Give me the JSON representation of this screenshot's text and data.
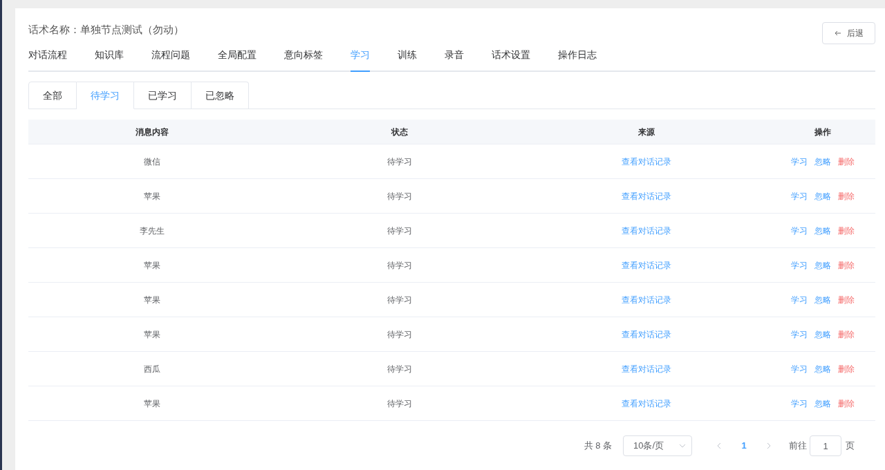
{
  "header": {
    "title": "话术名称：单独节点测试（勿动）",
    "back_button": "后退"
  },
  "tabs": [
    {
      "label": "对话流程",
      "selected": false
    },
    {
      "label": "知识库",
      "selected": false
    },
    {
      "label": "流程问题",
      "selected": false
    },
    {
      "label": "全局配置",
      "selected": false
    },
    {
      "label": "意向标签",
      "selected": false
    },
    {
      "label": "学习",
      "selected": true
    },
    {
      "label": "训练",
      "selected": false
    },
    {
      "label": "录音",
      "selected": false
    },
    {
      "label": "话术设置",
      "selected": false
    },
    {
      "label": "操作日志",
      "selected": false
    }
  ],
  "sub_tabs": [
    {
      "label": "全部",
      "selected": false
    },
    {
      "label": "待学习",
      "selected": true
    },
    {
      "label": "已学习",
      "selected": false
    },
    {
      "label": "已忽略",
      "selected": false
    }
  ],
  "table": {
    "columns": [
      "消息内容",
      "状态",
      "来源",
      "操作"
    ],
    "rows": [
      {
        "message": "微信",
        "status": "待学习",
        "source": "查看对话记录",
        "actions": [
          {
            "label": "学习",
            "kind": "primary"
          },
          {
            "label": "忽略",
            "kind": "primary"
          },
          {
            "label": "删除",
            "kind": "danger"
          }
        ]
      },
      {
        "message": "苹果",
        "status": "待学习",
        "source": "查看对话记录",
        "actions": [
          {
            "label": "学习",
            "kind": "primary"
          },
          {
            "label": "忽略",
            "kind": "primary"
          },
          {
            "label": "删除",
            "kind": "danger"
          }
        ]
      },
      {
        "message": "李先生",
        "status": "待学习",
        "source": "查看对话记录",
        "actions": [
          {
            "label": "学习",
            "kind": "primary"
          },
          {
            "label": "忽略",
            "kind": "primary"
          },
          {
            "label": "删除",
            "kind": "danger"
          }
        ]
      },
      {
        "message": "苹果",
        "status": "待学习",
        "source": "查看对话记录",
        "actions": [
          {
            "label": "学习",
            "kind": "primary"
          },
          {
            "label": "忽略",
            "kind": "primary"
          },
          {
            "label": "删除",
            "kind": "danger"
          }
        ]
      },
      {
        "message": "苹果",
        "status": "待学习",
        "source": "查看对话记录",
        "actions": [
          {
            "label": "学习",
            "kind": "primary"
          },
          {
            "label": "忽略",
            "kind": "primary"
          },
          {
            "label": "删除",
            "kind": "danger"
          }
        ]
      },
      {
        "message": "苹果",
        "status": "待学习",
        "source": "查看对话记录",
        "actions": [
          {
            "label": "学习",
            "kind": "primary"
          },
          {
            "label": "忽略",
            "kind": "primary"
          },
          {
            "label": "删除",
            "kind": "danger"
          }
        ]
      },
      {
        "message": "西瓜",
        "status": "待学习",
        "source": "查看对话记录",
        "actions": [
          {
            "label": "学习",
            "kind": "primary"
          },
          {
            "label": "忽略",
            "kind": "primary"
          },
          {
            "label": "删除",
            "kind": "danger"
          }
        ]
      },
      {
        "message": "苹果",
        "status": "待学习",
        "source": "查看对话记录",
        "actions": [
          {
            "label": "学习",
            "kind": "primary"
          },
          {
            "label": "忽略",
            "kind": "primary"
          },
          {
            "label": "删除",
            "kind": "danger"
          }
        ]
      }
    ]
  },
  "pagination": {
    "total": "共 8 条",
    "page_size": "10条/页",
    "pages": [
      {
        "label": "1",
        "selected": true
      }
    ],
    "goto_label": "前往",
    "goto_value": "1",
    "goto_suffix": "页"
  }
}
